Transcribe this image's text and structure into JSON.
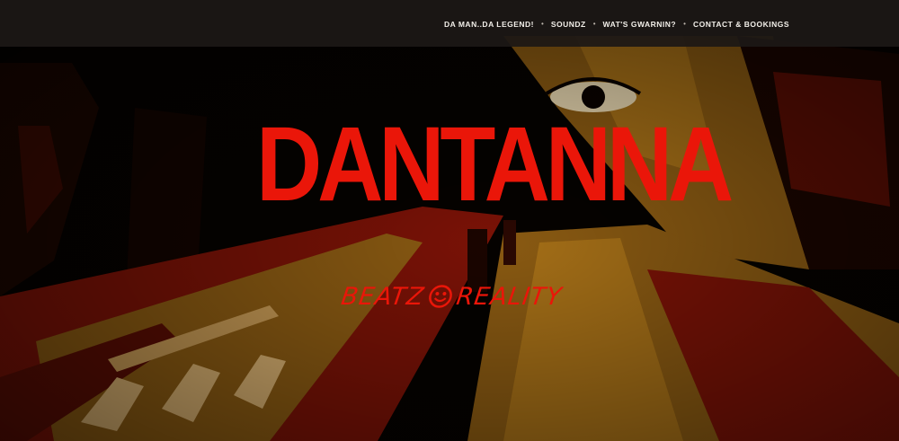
{
  "nav": {
    "items": [
      {
        "label": "DA MAN..DA LEGEND!"
      },
      {
        "label": "SOUNDZ"
      },
      {
        "label": "WAT'S GWARNIN?"
      },
      {
        "label": "CONTACT & BOOKINGS"
      }
    ],
    "separator": "•"
  },
  "hero": {
    "title": "DANTANNA",
    "tagline": {
      "left": "BEATZ",
      "right": "REALITY",
      "icon": "smiley-icon"
    }
  },
  "colors": {
    "brand_red": "#ea1609",
    "navbar_bg": "#1c1816",
    "nav_text": "#f2efe9",
    "ochre": "#8a5a12",
    "dark_red": "#7a1206"
  }
}
